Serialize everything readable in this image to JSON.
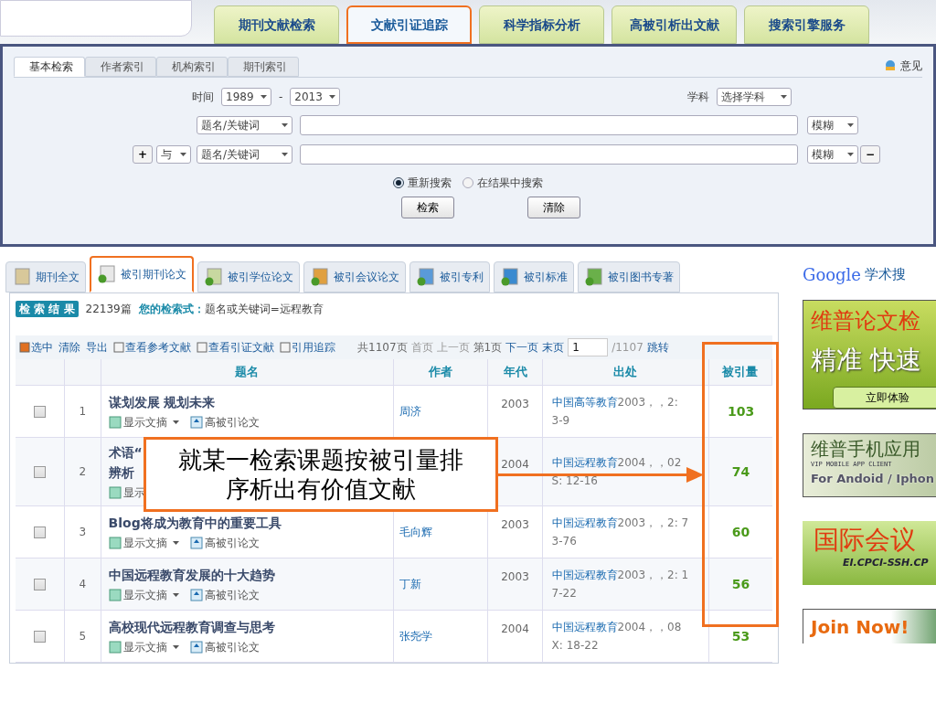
{
  "nav_tabs": [
    {
      "label": "期刊文献检索",
      "selected": false
    },
    {
      "label": "文献引证追踪",
      "selected": true
    },
    {
      "label": "科学指标分析",
      "selected": false
    },
    {
      "label": "高被引析出文献",
      "selected": false
    },
    {
      "label": "搜索引擎服务",
      "selected": false
    }
  ],
  "search_panel": {
    "subtabs": [
      {
        "label": "基本检索",
        "selected": true
      },
      {
        "label": "作者索引",
        "selected": false
      },
      {
        "label": "机构索引",
        "selected": false
      },
      {
        "label": "期刊索引",
        "selected": false
      }
    ],
    "feedback": "意见",
    "time_label": "时间",
    "from_year": "1989",
    "dash": "-",
    "to_year": "2013",
    "subject_label": "学科",
    "subject": "选择学科",
    "rows": [
      {
        "field": "题名/关键词",
        "match": "模糊"
      },
      {
        "plus": "+",
        "logic": "与",
        "field": "题名/关键词",
        "match": "模糊",
        "minus": "−"
      }
    ],
    "radios": [
      {
        "label": "重新搜索",
        "selected": true
      },
      {
        "label": "在结果中搜索",
        "selected": false
      }
    ],
    "buttons": [
      "检索",
      "清除"
    ]
  },
  "result_tabs": [
    {
      "label": "期刊全文",
      "selected": false
    },
    {
      "label": "被引期刊论文",
      "selected": true
    },
    {
      "label": "被引学位论文",
      "selected": false
    },
    {
      "label": "被引会议论文",
      "selected": false
    },
    {
      "label": "被引专利",
      "selected": false
    },
    {
      "label": "被引标准",
      "selected": false
    },
    {
      "label": "被引图书专著",
      "selected": false
    }
  ],
  "results": {
    "badge": "检 索 结 果",
    "count": "22139篇",
    "query_label": "您的检索式：",
    "query": "题名或关键词=远程教育",
    "actions": [
      "选中",
      "清除",
      "导出",
      "查看参考文献",
      "查看引证文献",
      "引用追踪"
    ],
    "pager": {
      "total": "共1107页",
      "first": "首页",
      "prev": "上一页",
      "current": "第1页",
      "next": "下一页",
      "last": "末页",
      "page_input": "1",
      "of": "/1107",
      "go": "跳转"
    },
    "columns": [
      "题名",
      "作者",
      "年代",
      "出处",
      "被引量"
    ],
    "rows": [
      {
        "checked": false,
        "index": "1",
        "title": [
          "谋划发展 规划未来"
        ],
        "author": "周济",
        "year": "2003",
        "source_link": "中国高等教育",
        "source_rest": "2003，，2:",
        "source_line2": "3-9",
        "cited": "103",
        "abstract": "显示文摘",
        "highly_cited": "高被引论文"
      },
      {
        "checked": false,
        "index": "2",
        "title": [
          "术语“",
          "辨析"
        ],
        "year": "2004",
        "source_link": "中国远程教育",
        "source_rest": "2004，，02",
        "source_line2": "S: 12-16",
        "cited": "74",
        "abstract": "显示"
      },
      {
        "checked": false,
        "index": "3",
        "title": [
          "Blog将成为教育中的重要工具"
        ],
        "author": "毛向辉",
        "year": "2003",
        "source_link": "中国远程教育",
        "source_rest": "2003，，2: 7",
        "source_line2": "3-76",
        "cited": "60",
        "abstract": "显示文摘",
        "highly_cited": "高被引论文"
      },
      {
        "checked": false,
        "index": "4",
        "title": [
          "中国远程教育发展的十大趋势"
        ],
        "author": "丁新",
        "year": "2003",
        "source_link": "中国远程教育",
        "source_rest": "2003，，2: 1",
        "source_line2": "7-22",
        "cited": "56",
        "abstract": "显示文摘",
        "highly_cited": "高被引论文"
      },
      {
        "checked": false,
        "index": "5",
        "title": [
          "高校现代远程教育调查与思考"
        ],
        "author": "张尧学",
        "year": "2004",
        "source_link": "中国远程教育",
        "source_rest": "2004，，08",
        "source_line2": "X: 18-22",
        "cited": "53",
        "abstract": "显示文摘",
        "highly_cited": "高被引论文"
      }
    ]
  },
  "sidebar": {
    "google": "Google",
    "google_suffix": "学术搜",
    "ads": [
      {
        "kind": "detect",
        "title": "维普论文检",
        "slogan": "精准 快速",
        "button": "立即体验"
      },
      {
        "kind": "mobile",
        "title": "维普手机应用",
        "subtitle": "VIP MOBILE APP CLIENT",
        "platforms": "For Andoid / Iphon"
      },
      {
        "kind": "conference",
        "title": "国际会议",
        "subtitle": "EI.CPCI-SSH.CP"
      },
      {
        "kind": "join",
        "title": "Join Now!"
      }
    ]
  },
  "callout": "就某一检索课题按被引量排序析出有价值文献"
}
